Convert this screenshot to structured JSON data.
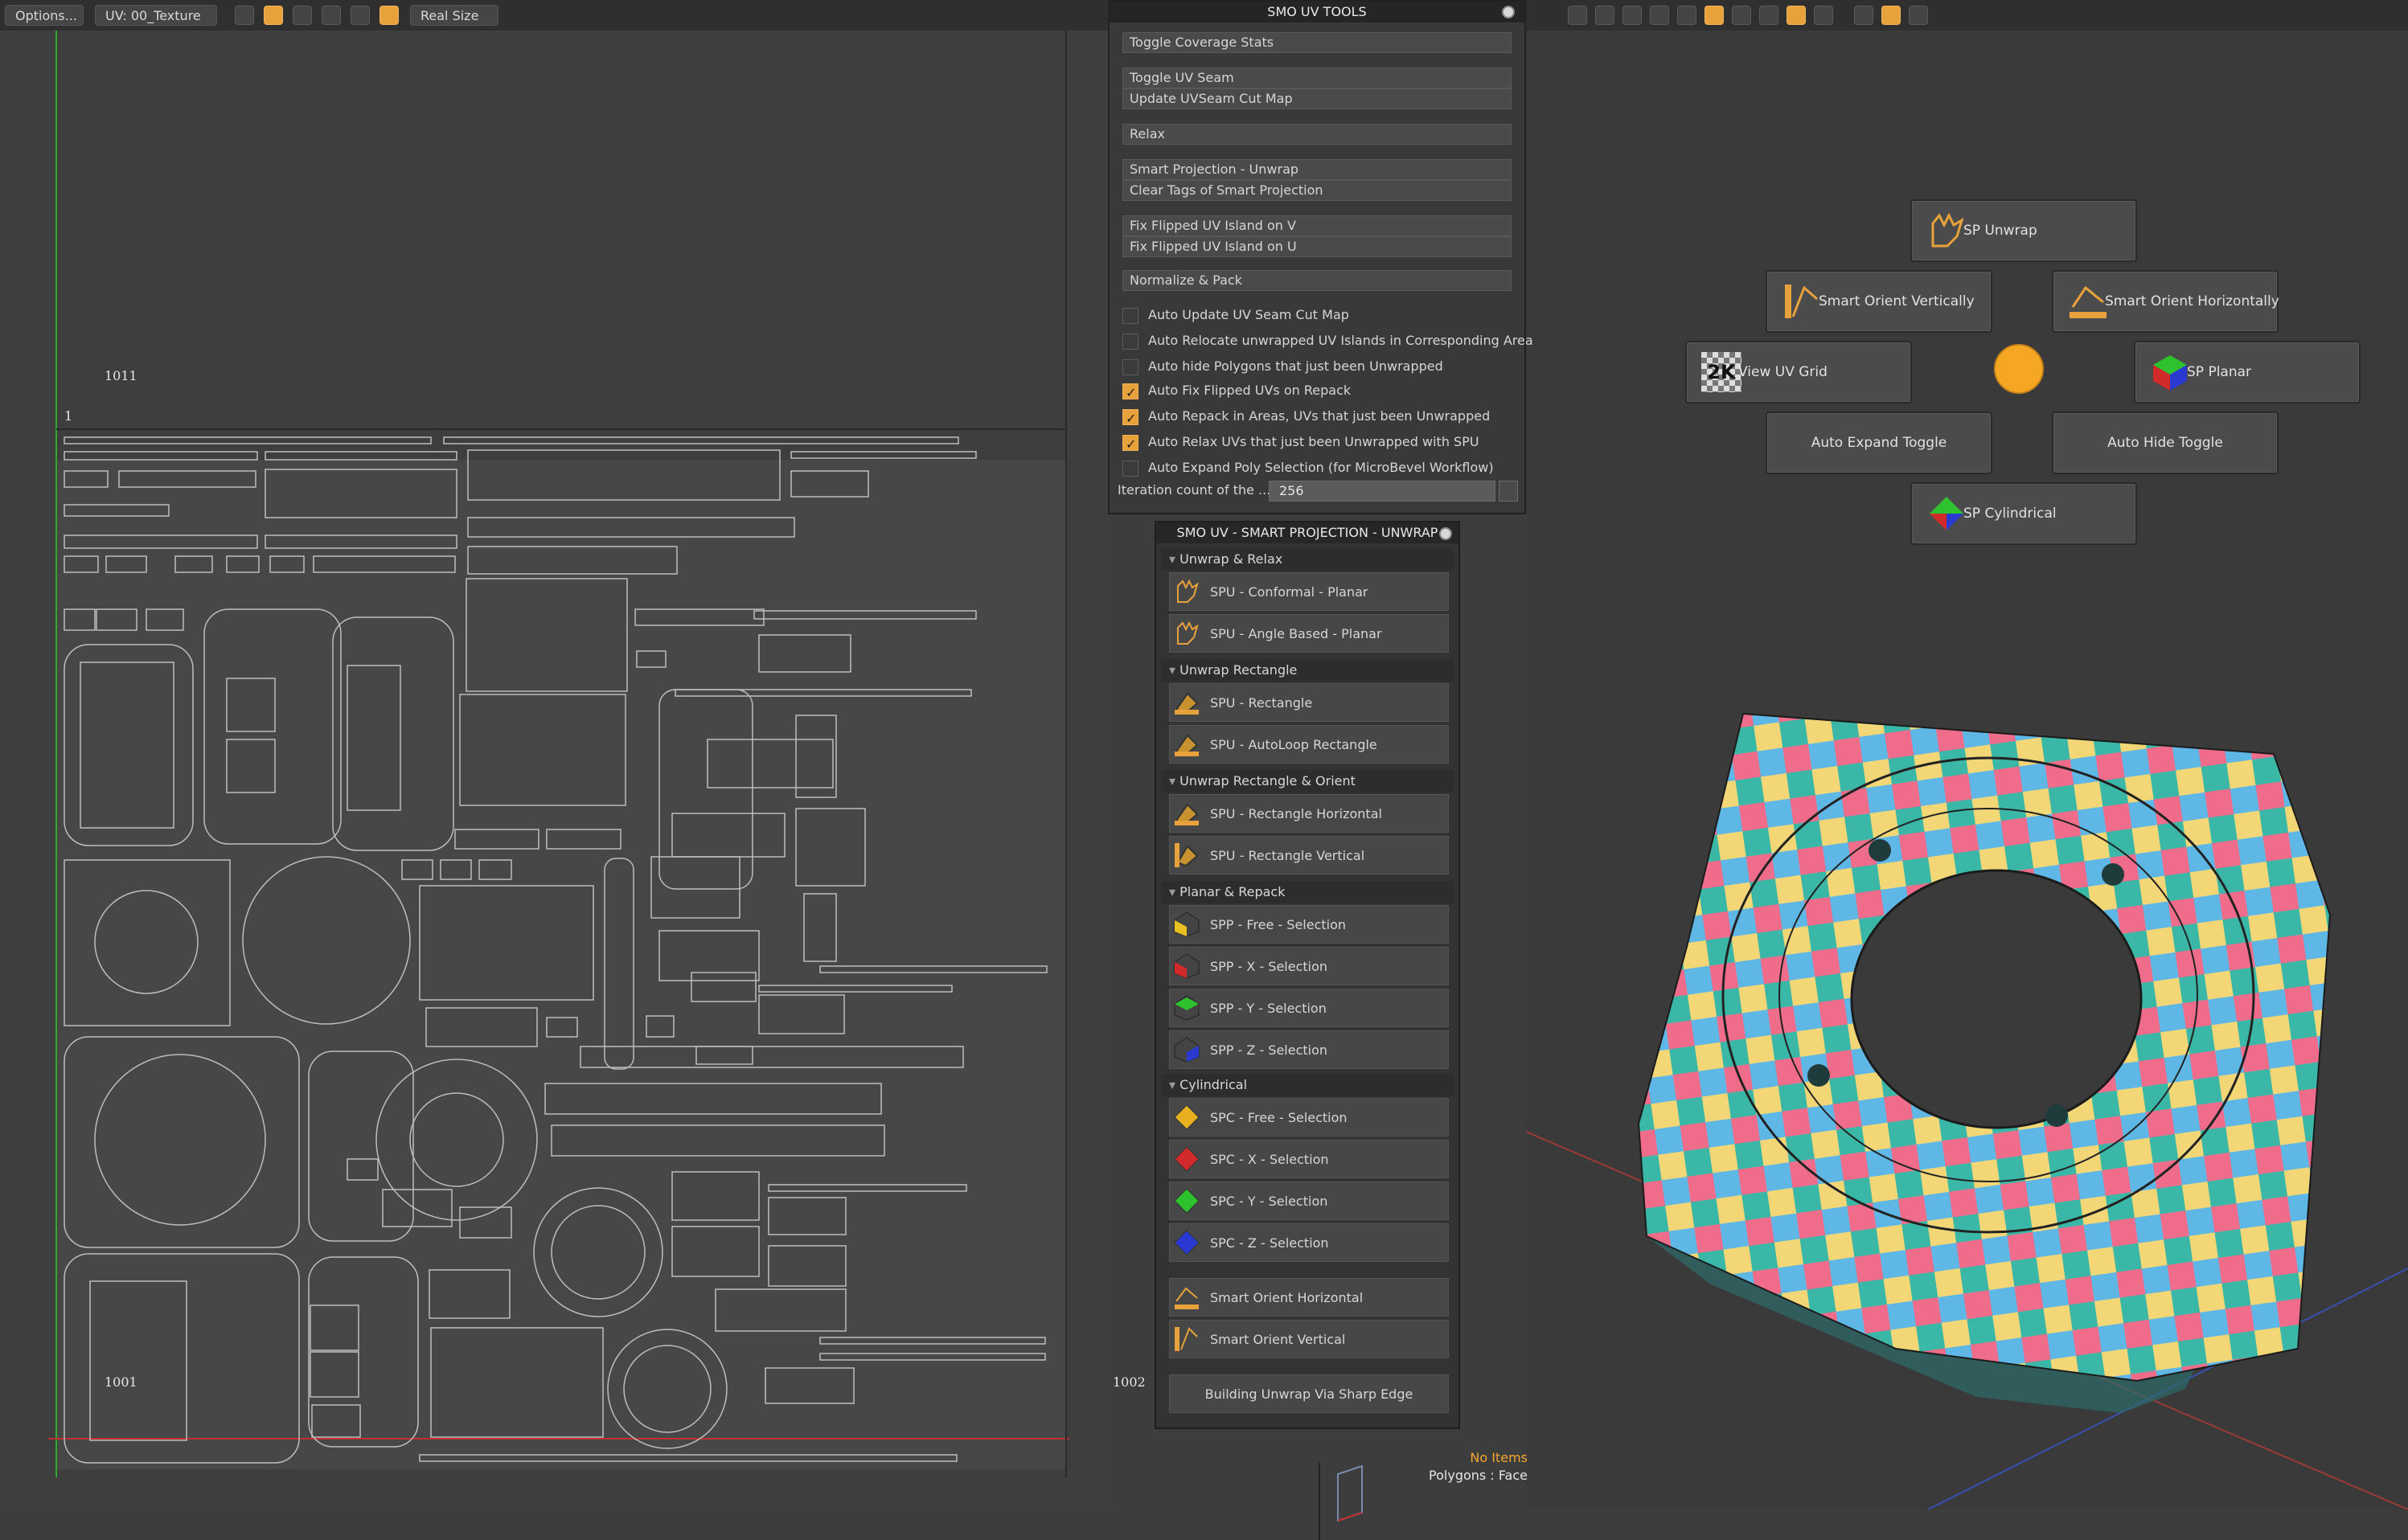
{
  "toolbar": {
    "options_label": "Options...",
    "uv_map_label": "UV: 00_Texture",
    "real_size_label": "Real Size"
  },
  "uv_view": {
    "tile_1011": "1011",
    "tile_1001": "1001",
    "tile_1002": "1002",
    "axis_marker": "1"
  },
  "smo_uv_tools": {
    "title": "SMO UV TOOLS",
    "buttons": [
      "Toggle Coverage Stats",
      "Toggle UV Seam",
      "Update UVSeam Cut Map",
      "Relax",
      "Smart Projection - Unwrap",
      "Clear Tags of Smart Projection",
      "Fix Flipped UV Island on V",
      "Fix Flipped UV Island on U",
      "Normalize & Pack"
    ],
    "checkboxes": [
      {
        "label": "Auto Update UV Seam Cut Map",
        "checked": false
      },
      {
        "label": "Auto Relocate unwrapped UV Islands in Corresponding Area",
        "checked": false
      },
      {
        "label": "Auto hide Polygons that just been Unwrapped",
        "checked": false
      },
      {
        "label": "Auto Fix Flipped UVs on Repack",
        "checked": true
      },
      {
        "label": "Auto Repack in Areas, UVs that just been Unwrapped",
        "checked": true
      },
      {
        "label": "Auto Relax UVs that just been Unwrapped with SPU",
        "checked": true
      },
      {
        "label": "Auto Expand Poly Selection (for MicroBevel Workflow)",
        "checked": false
      }
    ],
    "iteration_label": "Iteration count of the ...",
    "iteration_value": "256"
  },
  "smart_projection": {
    "title": "SMO UV - SMART PROJECTION - UNWRAP",
    "sections": [
      {
        "header": "Unwrap & Relax",
        "items": [
          "SPU - Conformal - Planar",
          "SPU - Angle Based - Planar"
        ]
      },
      {
        "header": "Unwrap Rectangle",
        "items": [
          "SPU - Rectangle",
          "SPU - AutoLoop Rectangle"
        ]
      },
      {
        "header": "Unwrap Rectangle & Orient",
        "items": [
          "SPU - Rectangle Horizontal",
          "SPU - Rectangle Vertical"
        ]
      },
      {
        "header": "Planar & Repack",
        "items": [
          "SPP - Free - Selection",
          "SPP - X - Selection",
          "SPP - Y - Selection",
          "SPP - Z - Selection"
        ]
      },
      {
        "header": "Cylindrical",
        "items": [
          "SPC - Free - Selection",
          "SPC - X - Selection",
          "SPC - Y - Selection",
          "SPC - Z - Selection"
        ]
      }
    ],
    "orient_items": [
      "Smart Orient Horizontal",
      "Smart Orient Vertical"
    ],
    "sharp_edge_button": "Building Unwrap Via Sharp Edge"
  },
  "pie_menu": {
    "sp_unwrap": "SP Unwrap",
    "smart_orient_vertically": "Smart Orient Vertically",
    "smart_orient_horizontally": "Smart Orient Horizontally",
    "view_uv_grid": "View UV Grid",
    "view_uv_grid_badge": "2K",
    "sp_planar": "SP Planar",
    "auto_expand_toggle": "Auto Expand Toggle",
    "auto_hide_toggle": "Auto Hide Toggle",
    "sp_cylindrical": "SP Cylindrical"
  },
  "status_bar": {
    "items": "No Items",
    "polygons": "Polygons : Face"
  },
  "colors": {
    "accent": "#e8a23c",
    "pie_center": "#f5a623",
    "axis_x": "#d0302a",
    "axis_y": "#2eaa2e",
    "axis_z": "#3050d0"
  }
}
